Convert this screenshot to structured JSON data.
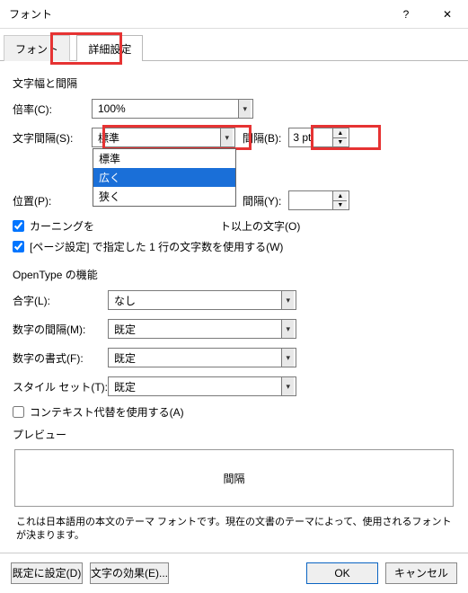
{
  "window": {
    "title": "フォント",
    "help": "?",
    "close": "✕"
  },
  "tabs": {
    "font": "フォント",
    "advanced": "詳細設定"
  },
  "section1": {
    "title": "文字幅と間隔",
    "scale": {
      "label": "倍率(C):",
      "value": "100%"
    },
    "spacing": {
      "label": "文字間隔(S):",
      "value": "標準",
      "options": [
        "標準",
        "広く",
        "狭く"
      ],
      "by_label": "間隔(B):",
      "by_value": "3 pt"
    },
    "position": {
      "label": "位置(P):",
      "value": "",
      "by_label": "間隔(Y):",
      "by_value": ""
    },
    "kerning": {
      "label_pre": "カーニングを",
      "label_post": "ト以上の文字(O)"
    },
    "pagegrid": "[ページ設定] で指定した 1 行の文字数を使用する(W)"
  },
  "section2": {
    "title": "OpenType の機能",
    "ligatures": {
      "label": "合字(L):",
      "value": "なし"
    },
    "numspacing": {
      "label": "数字の間隔(M):",
      "value": "既定"
    },
    "numform": {
      "label": "数字の書式(F):",
      "value": "既定"
    },
    "styleset": {
      "label": "スタイル セット(T):",
      "value": "既定"
    },
    "contextual": "コンテキスト代替を使用する(A)"
  },
  "preview": {
    "title": "プレビュー",
    "sample": "間隔",
    "note": "これは日本語用の本文のテーマ フォントです。現在の文書のテーマによって、使用されるフォントが決まります。"
  },
  "footer": {
    "setdefault": "既定に設定(D)",
    "texteffects": "文字の効果(E)...",
    "ok": "OK",
    "cancel": "キャンセル"
  }
}
